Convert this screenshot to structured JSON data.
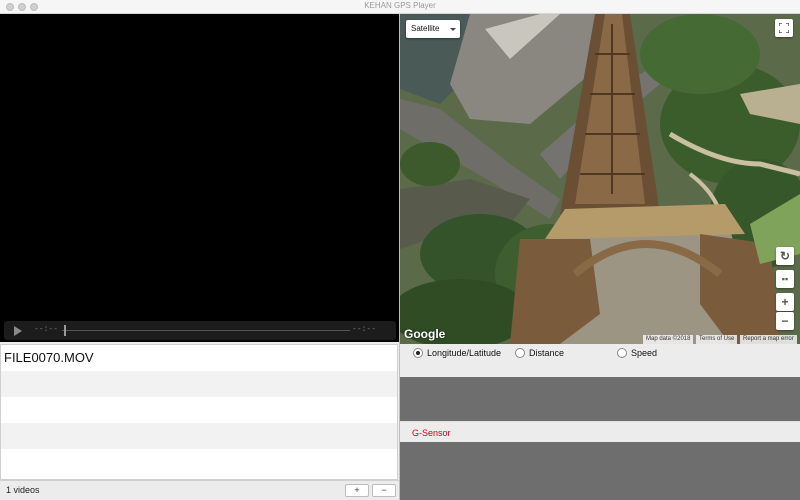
{
  "window": {
    "title": "KEHAN GPS Player"
  },
  "player": {
    "time_elapsed": "--:--",
    "time_remaining": "--:--"
  },
  "files": {
    "items": [
      "FILE0070.MOV",
      "",
      "",
      "",
      ""
    ],
    "count_label": "1 videos",
    "add_label": "+",
    "remove_label": "−"
  },
  "map": {
    "type_selected": "Satellite",
    "logo": "Google",
    "attribution": {
      "map_data": "Map data ©2018",
      "terms": "Terms of Use",
      "report": "Report a map error"
    },
    "zoom_in": "+",
    "zoom_out": "−"
  },
  "chart_options": {
    "modes": [
      {
        "label": "Longitude/Latitude",
        "selected": true
      },
      {
        "label": "Distance",
        "selected": false
      },
      {
        "label": "Speed",
        "selected": false
      }
    ]
  },
  "gsensor": {
    "label": "G-Sensor",
    "label_color": "#d0021b"
  },
  "icons": {
    "play": "play-icon",
    "fullscreen": "fullscreen-icon",
    "rotate": "rotate-icon",
    "pegman": "street-view-icon"
  }
}
